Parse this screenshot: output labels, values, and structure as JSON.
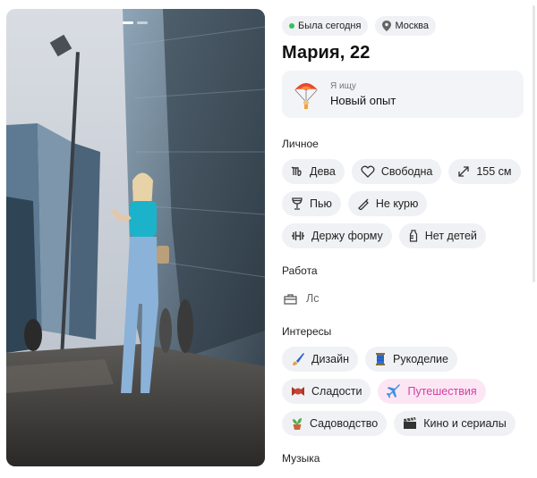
{
  "status": {
    "last_seen": "Была сегодня",
    "city": "Москва"
  },
  "profile": {
    "name_age": "Мария, 22"
  },
  "looking_for": {
    "label": "Я ищу",
    "value": "Новый опыт"
  },
  "sections": {
    "personal": "Личное",
    "work": "Работа",
    "interests": "Интересы",
    "music": "Музыка"
  },
  "personal": {
    "zodiac": "Дева",
    "relationship": "Свободна",
    "height": "155 см",
    "drinking": "Пью",
    "smoking": "Не курю",
    "fitness": "Держу форму",
    "children": "Нет детей"
  },
  "work": {
    "value": "Лс"
  },
  "interests": {
    "design": "Дизайн",
    "crafts": "Рукоделие",
    "sweets": "Сладости",
    "travel": "Путешествия",
    "gardening": "Садоводство",
    "movies": "Кино и сериалы"
  },
  "colors": {
    "online": "#2ec35b",
    "accent": "#d23fa0",
    "chip_bg": "#f0f1f4"
  }
}
